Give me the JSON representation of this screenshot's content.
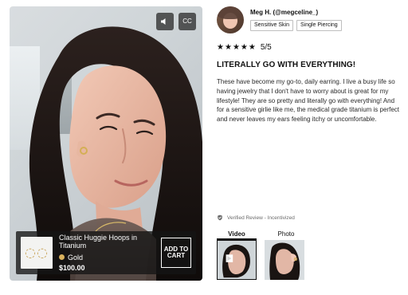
{
  "video": {
    "controls": {
      "sound_icon": "speaker-icon",
      "cc_label": "CC"
    },
    "product": {
      "thumb_icon": "hoops-icon",
      "name": "Classic Huggie Hoops in Titanium",
      "variant": "Gold",
      "price": "$100.00",
      "cart_label": "ADD TO CART",
      "swatch_color": "#d8b15d"
    }
  },
  "review": {
    "reviewer_name": "Meg H. (@megceline_)",
    "tags": [
      "Sensitive Skin",
      "Single Piercing"
    ],
    "rating_text": "5/5",
    "title": "LITERALLY GO WITH EVERYTHING!",
    "body": "These have become my go-to, daily earring. I live a busy life so having jewelry that I don't have to worry about is great for my lifestyle! They are so pretty and literally go with everything! And for a sensitive girlie like me, the medical grade titanium is perfect and never leaves my ears feeling itchy or uncomfortable.",
    "verified_text": "Verified Review - Incentivized"
  },
  "media": {
    "tabs": [
      "Video",
      "Photo"
    ]
  },
  "colors": {
    "text_primary": "#111111",
    "text_secondary": "#2a2a2a",
    "muted": "#6b6b6b",
    "border": "#bfbfbf"
  }
}
